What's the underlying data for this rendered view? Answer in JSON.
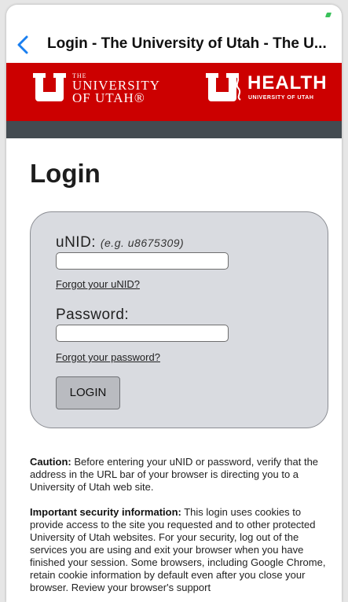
{
  "nav": {
    "title": "Login - The University of Utah - The U..."
  },
  "banner": {
    "left_the": "THE",
    "left_line1": "UNIVERSITY",
    "left_line2": "OF UTAH®",
    "right_word": "HEALTH",
    "right_sub": "UNIVERSITY OF UTAH",
    "color": "#cc0000"
  },
  "page": {
    "heading": "Login"
  },
  "form": {
    "unid_label": "uNID:",
    "unid_hint": "(e.g. u8675309)",
    "unid_value": "",
    "forgot_unid": "Forgot your uNID?",
    "password_label": "Password:",
    "password_value": "",
    "forgot_password": "Forgot your password?",
    "login_button": "LOGIN"
  },
  "info": {
    "caution_heading": "Caution:",
    "caution_text": " Before entering your uNID or password, verify that the address in the URL bar of your browser is directing you to a University of Utah web site.",
    "security_heading": "Important security information:",
    "security_text": " This login uses cookies to provide access to the site you requested and to other protected University of Utah websites. For your security, log out of the services you are using and exit your browser when you have finished your session. Some browsers, including Google Chrome, retain cookie information by default even after you close your browser. Review your browser's support"
  }
}
